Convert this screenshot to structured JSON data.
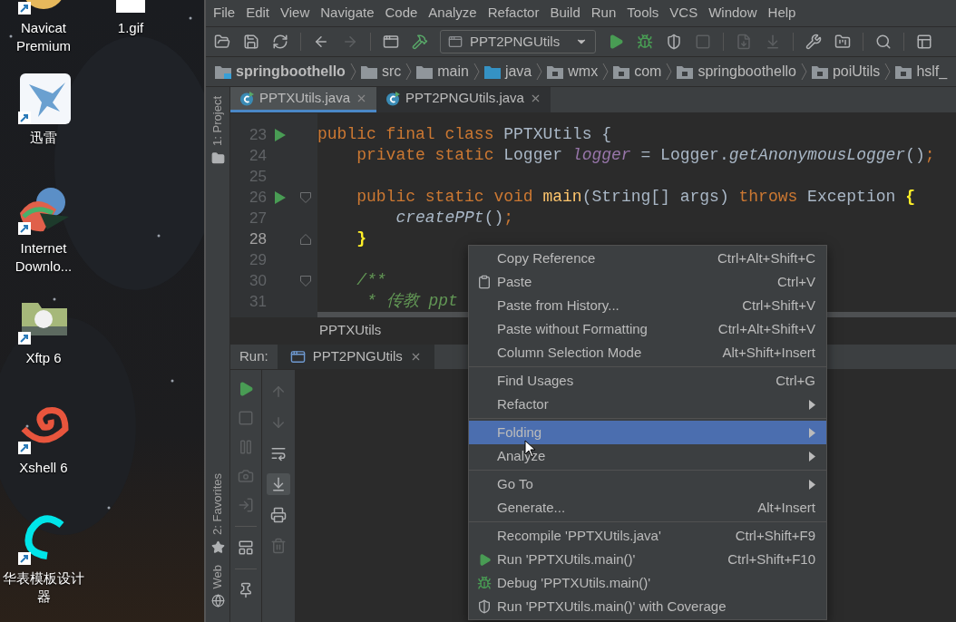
{
  "desktop": {
    "columns": [
      [
        {
          "label": "Navicat Premium",
          "kind": "navicat"
        },
        {
          "label": "迅雷",
          "kind": "thunder"
        },
        {
          "label": "Internet Downlo...",
          "kind": "idm"
        },
        {
          "label": "Xftp 6",
          "kind": "xftp"
        },
        {
          "label": "Xshell 6",
          "kind": "xshell"
        },
        {
          "label": "华表模板设计器",
          "kind": "curve"
        }
      ],
      [
        {
          "label": "1.gif",
          "kind": "image-file"
        }
      ]
    ]
  },
  "menu_bar": [
    {
      "label": "File"
    },
    {
      "label": "Edit"
    },
    {
      "label": "View"
    },
    {
      "label": "Navigate"
    },
    {
      "label": "Code"
    },
    {
      "label": "Analyze"
    },
    {
      "label": "Refactor"
    },
    {
      "label": "Build"
    },
    {
      "label": "Run"
    },
    {
      "label": "Tools"
    },
    {
      "label": "VCS"
    },
    {
      "label": "Window"
    },
    {
      "label": "Help"
    }
  ],
  "toolbar": [
    {
      "kind": "open",
      "disabled": false
    },
    {
      "kind": "save",
      "disabled": false
    },
    {
      "kind": "sync",
      "disabled": false
    },
    {
      "kind": "separator"
    },
    {
      "kind": "back",
      "disabled": false
    },
    {
      "kind": "forward",
      "disabled": true
    },
    {
      "kind": "separator"
    },
    {
      "kind": "console",
      "disabled": false
    },
    {
      "kind": "build",
      "disabled": false
    },
    {
      "kind": "config",
      "label": "PPT2PNGUtils",
      "disabled": false
    },
    {
      "kind": "run",
      "disabled": false
    },
    {
      "kind": "debug",
      "disabled": false
    },
    {
      "kind": "coverage",
      "disabled": false
    },
    {
      "kind": "stop",
      "disabled": true
    },
    {
      "kind": "separator"
    },
    {
      "kind": "attach",
      "disabled": true
    },
    {
      "kind": "download",
      "disabled": true
    },
    {
      "kind": "separator"
    },
    {
      "kind": "settings",
      "disabled": false
    },
    {
      "kind": "structure",
      "disabled": false
    },
    {
      "kind": "separator"
    },
    {
      "kind": "search",
      "disabled": false
    },
    {
      "kind": "separator"
    },
    {
      "kind": "tasks",
      "disabled": false
    }
  ],
  "breadcrumb": [
    {
      "label": "springboothello",
      "kind": "module"
    },
    {
      "label": "src",
      "kind": "folder"
    },
    {
      "label": "main",
      "kind": "folder"
    },
    {
      "label": "java",
      "kind": "source"
    },
    {
      "label": "wmx",
      "kind": "package"
    },
    {
      "label": "com",
      "kind": "package"
    },
    {
      "label": "springboothello",
      "kind": "package"
    },
    {
      "label": "poiUtils",
      "kind": "package"
    },
    {
      "label": "hslf_",
      "kind": "package"
    }
  ],
  "side_tabs": [
    {
      "label": "1: Project",
      "kind": "project"
    },
    {
      "label": "2: Favorites",
      "kind": "favorites"
    },
    {
      "label": "Web",
      "kind": "web"
    }
  ],
  "editor_tabs": [
    {
      "label": "PPTXUtils.java",
      "selected": true
    },
    {
      "label": "PPT2PNGUtils.java",
      "selected": false
    }
  ],
  "editor": {
    "lines": [
      {
        "number": "23",
        "run_marker": true,
        "fold_start": false,
        "fold_end": false,
        "current": false,
        "tokens": [
          {
            "kind": "keyword",
            "text": "public final class "
          },
          {
            "kind": "plain",
            "text": "PPTXUtils {"
          }
        ]
      },
      {
        "number": "24",
        "run_marker": false,
        "fold_start": false,
        "fold_end": false,
        "current": false,
        "tokens": [
          {
            "kind": "keyword",
            "text": "    private static "
          },
          {
            "kind": "plain",
            "text": "Logger "
          },
          {
            "kind": "field",
            "text": "logger"
          },
          {
            "kind": "plain",
            "text": " = Logger."
          },
          {
            "kind": "static-call",
            "text": "getAnonymousLogger"
          },
          {
            "kind": "plain",
            "text": "()"
          },
          {
            "kind": "keyword",
            "text": ";"
          }
        ]
      },
      {
        "number": "25",
        "run_marker": false,
        "fold_start": false,
        "fold_end": false,
        "current": false
      },
      {
        "number": "26",
        "run_marker": true,
        "fold_start": true,
        "fold_end": false,
        "current": false,
        "tokens": [
          {
            "kind": "keyword",
            "text": "    public static void "
          },
          {
            "kind": "declaration",
            "text": "main"
          },
          {
            "kind": "plain",
            "text": "(String[] args) "
          },
          {
            "kind": "keyword",
            "text": "throws"
          },
          {
            "kind": "plain",
            "text": " Exception "
          },
          {
            "kind": "brace",
            "text": "{"
          }
        ]
      },
      {
        "number": "27",
        "run_marker": false,
        "fold_start": false,
        "fold_end": false,
        "current": false,
        "tokens": [
          {
            "kind": "static-call",
            "text": "        createPPt"
          },
          {
            "kind": "plain",
            "text": "()"
          },
          {
            "kind": "keyword",
            "text": ";"
          }
        ]
      },
      {
        "number": "28",
        "run_marker": false,
        "fold_start": false,
        "fold_end": true,
        "current": true,
        "tokens": [
          {
            "kind": "brace",
            "text": "    }"
          }
        ]
      },
      {
        "number": "29",
        "run_marker": false,
        "fold_start": false,
        "fold_end": false,
        "current": false
      },
      {
        "number": "30",
        "run_marker": false,
        "fold_start": true,
        "fold_end": false,
        "current": false,
        "tokens": [
          {
            "kind": "doc-comment",
            "text": "    /**"
          }
        ]
      },
      {
        "number": "31",
        "run_marker": false,
        "fold_start": false,
        "fold_end": false,
        "current": false,
        "tokens": [
          {
            "kind": "doc-comment",
            "text": "     * 传教 ppt"
          }
        ]
      }
    ],
    "footer": "PPTXUtils"
  },
  "run_panel": {
    "title": "Run:",
    "tab": "PPT2PNGUtils",
    "left_tools": [
      {
        "kind": "rerun",
        "disabled": false
      },
      {
        "kind": "stop",
        "disabled": true
      },
      {
        "kind": "pause",
        "disabled": true
      },
      {
        "kind": "camera",
        "disabled": true
      },
      {
        "kind": "exit",
        "disabled": true
      },
      {
        "kind": "separator"
      },
      {
        "kind": "layout",
        "disabled": false
      },
      {
        "kind": "separator"
      },
      {
        "kind": "pin",
        "disabled": false
      }
    ],
    "right_tools": [
      {
        "kind": "up",
        "disabled": true,
        "selected": false
      },
      {
        "kind": "down",
        "disabled": true,
        "selected": false
      },
      {
        "kind": "wrap",
        "disabled": false,
        "selected": false
      },
      {
        "kind": "scroll-end",
        "disabled": false,
        "selected": true
      },
      {
        "kind": "print",
        "disabled": false,
        "selected": false
      },
      {
        "kind": "clear",
        "disabled": true,
        "selected": false
      }
    ]
  },
  "context_menu": {
    "groups": [
      [
        {
          "label": "Copy Reference",
          "shortcut": "Ctrl+Alt+Shift+C",
          "kind": "plain",
          "submenu": false,
          "selected": false
        },
        {
          "label": "Paste",
          "shortcut": "Ctrl+V",
          "kind": "paste",
          "submenu": false,
          "selected": false
        },
        {
          "label": "Paste from History...",
          "shortcut": "Ctrl+Shift+V",
          "kind": "plain",
          "submenu": false,
          "selected": false
        },
        {
          "label": "Paste without Formatting",
          "shortcut": "Ctrl+Alt+Shift+V",
          "kind": "plain",
          "submenu": false,
          "selected": false
        },
        {
          "label": "Column Selection Mode",
          "shortcut": "Alt+Shift+Insert",
          "kind": "plain",
          "submenu": false,
          "selected": false
        }
      ],
      [
        {
          "label": "Find Usages",
          "shortcut": "Ctrl+G",
          "kind": "plain",
          "submenu": false,
          "selected": false
        },
        {
          "label": "Refactor",
          "kind": "plain",
          "submenu": true,
          "selected": false
        }
      ],
      [
        {
          "label": "Folding",
          "kind": "plain",
          "submenu": true,
          "selected": true
        },
        {
          "label": "Analyze",
          "kind": "plain",
          "submenu": true,
          "selected": false
        }
      ],
      [
        {
          "label": "Go To",
          "kind": "plain",
          "submenu": true,
          "selected": false
        },
        {
          "label": "Generate...",
          "shortcut": "Alt+Insert",
          "kind": "plain",
          "submenu": false,
          "selected": false
        }
      ],
      [
        {
          "label": "Recompile 'PPTXUtils.java'",
          "shortcut": "Ctrl+Shift+F9",
          "kind": "plain",
          "submenu": false,
          "selected": false
        },
        {
          "label": "Run 'PPTXUtils.main()'",
          "shortcut": "Ctrl+Shift+F10",
          "kind": "run",
          "submenu": false,
          "selected": false
        },
        {
          "label": "Debug 'PPTXUtils.main()'",
          "kind": "debug",
          "submenu": false,
          "selected": false
        },
        {
          "label": "Run 'PPTXUtils.main()' with Coverage",
          "kind": "coverage",
          "submenu": false,
          "selected": false
        }
      ]
    ]
  }
}
